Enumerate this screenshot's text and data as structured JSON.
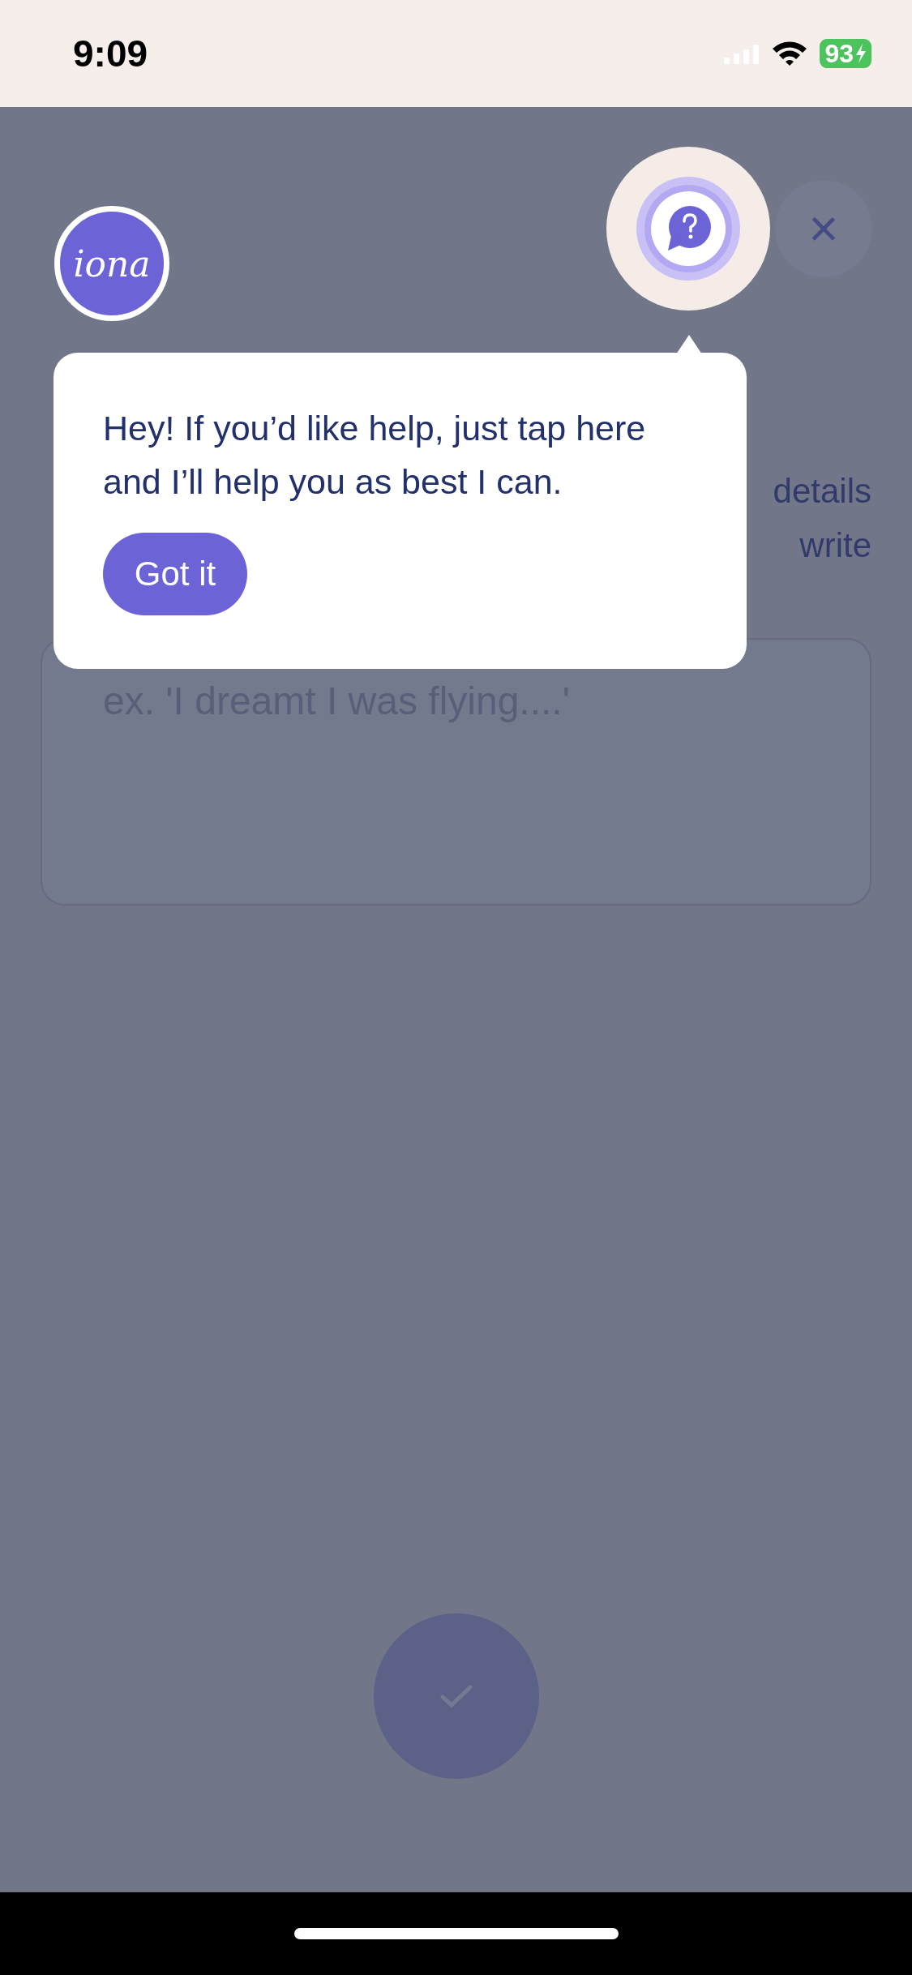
{
  "status_bar": {
    "time": "9:09",
    "battery": "93"
  },
  "avatar": {
    "label": "iona"
  },
  "background_page": {
    "paragraph_lines": [
      {
        "right": "details"
      },
      {
        "right": "write"
      }
    ],
    "entry_field": {
      "placeholder": "ex. 'I dreamt I was flying....'"
    }
  },
  "help_popup": {
    "message": "Hey! If you’d like help, just tap here and I’ll help you as best I can.",
    "button": "Got it"
  },
  "close_button": {
    "label": "×"
  }
}
